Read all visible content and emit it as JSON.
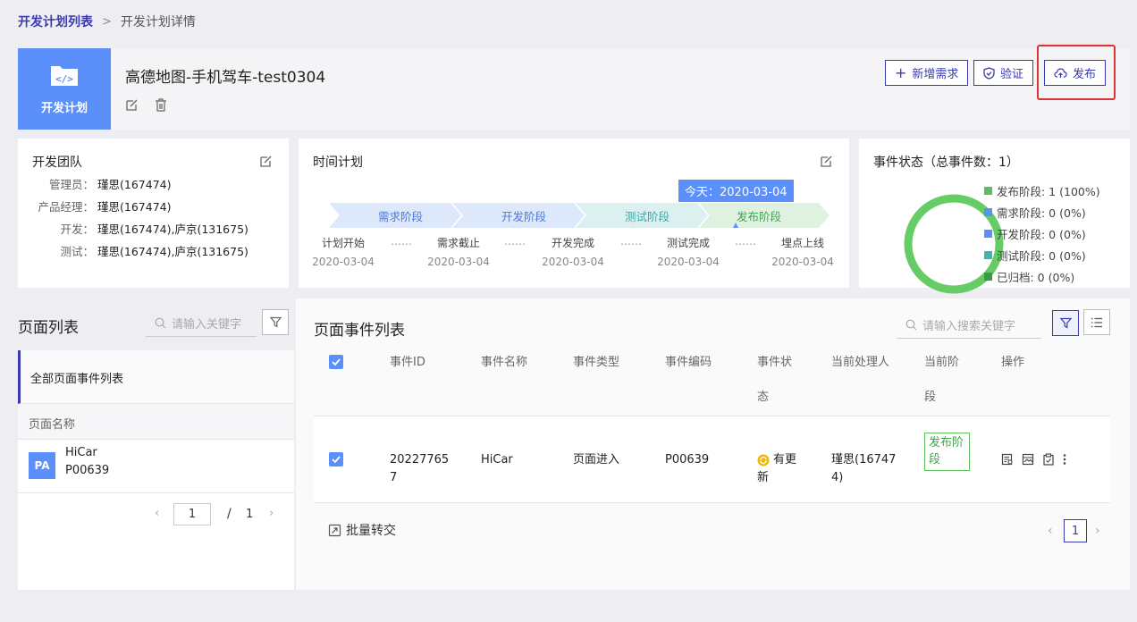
{
  "breadcrumb": {
    "parent": "开发计划列表",
    "separator": ">",
    "current": "开发计划详情"
  },
  "header": {
    "logo_label": "开发计划",
    "title": "高德地图-手机驾车-test0304",
    "buttons": {
      "add": "新增需求",
      "verify": "验证",
      "publish": "发布"
    }
  },
  "team": {
    "title": "开发团队",
    "rows": [
      {
        "key": "管理员：",
        "value": "瑾思(167474)"
      },
      {
        "key": "产品经理：",
        "value": "瑾思(167474)"
      },
      {
        "key": "开发：",
        "value": "瑾思(167474),庐京(131675)"
      },
      {
        "key": "测试：",
        "value": "瑾思(167474),庐京(131675)"
      }
    ]
  },
  "schedule": {
    "title": "时间计划",
    "today": "今天：2020-03-04",
    "stages": [
      "需求阶段",
      "开发阶段",
      "测试阶段",
      "发布阶段"
    ],
    "milestones": [
      {
        "label": "计划开始",
        "date": "2020-03-04"
      },
      {
        "label": "需求截止",
        "date": "2020-03-04"
      },
      {
        "label": "开发完成",
        "date": "2020-03-04"
      },
      {
        "label": "测试完成",
        "date": "2020-03-04"
      },
      {
        "label": "埋点上线",
        "date": "2020-03-04"
      }
    ],
    "dots": "……"
  },
  "status": {
    "title": "事件状态（总事件数：1）",
    "items": [
      {
        "label": "发布阶段: 1 (100%)",
        "color": "#5cbf5c"
      },
      {
        "label": "需求阶段: 0 (0%)",
        "color": "#5b8ff9"
      },
      {
        "label": "开发阶段: 0 (0%)",
        "color": "#5b8ff9"
      },
      {
        "label": "测试阶段: 0 (0%)",
        "color": "#3fb7b0"
      },
      {
        "label": "已归档: 0 (0%)",
        "color": "#3a9a4a"
      }
    ]
  },
  "page_list": {
    "title": "页面列表",
    "search_placeholder": "请输入关键字",
    "all_item": "全部页面事件列表",
    "column": "页面名称",
    "items": [
      {
        "avatar": "PA",
        "name": "HiCar",
        "code": "P00639"
      }
    ],
    "pager": {
      "current": "1",
      "sep": "/",
      "total": "1"
    }
  },
  "events": {
    "title": "页面事件列表",
    "search_placeholder": "请输入搜索关键字",
    "columns": [
      "事件ID",
      "事件名称",
      "事件类型",
      "事件编码",
      "事件状",
      "态",
      "当前处理人",
      "当前阶",
      "段",
      "操作"
    ],
    "row": {
      "id_line1": "20227765",
      "id_line2": "7",
      "name": "HiCar",
      "type": "页面进入",
      "code": "P00639",
      "status_line1": "有更",
      "status_line2": "新",
      "owner_line1": "瑾思(16747",
      "owner_line2": "4)",
      "stage_line1": "发布阶",
      "stage_line2": "段"
    },
    "batch": "批量转交",
    "page": "1"
  },
  "colors": {
    "accent": "#3a3ab0",
    "logo": "#5b8ff9",
    "green": "#5cbf5c",
    "highlight": "#d33333"
  }
}
